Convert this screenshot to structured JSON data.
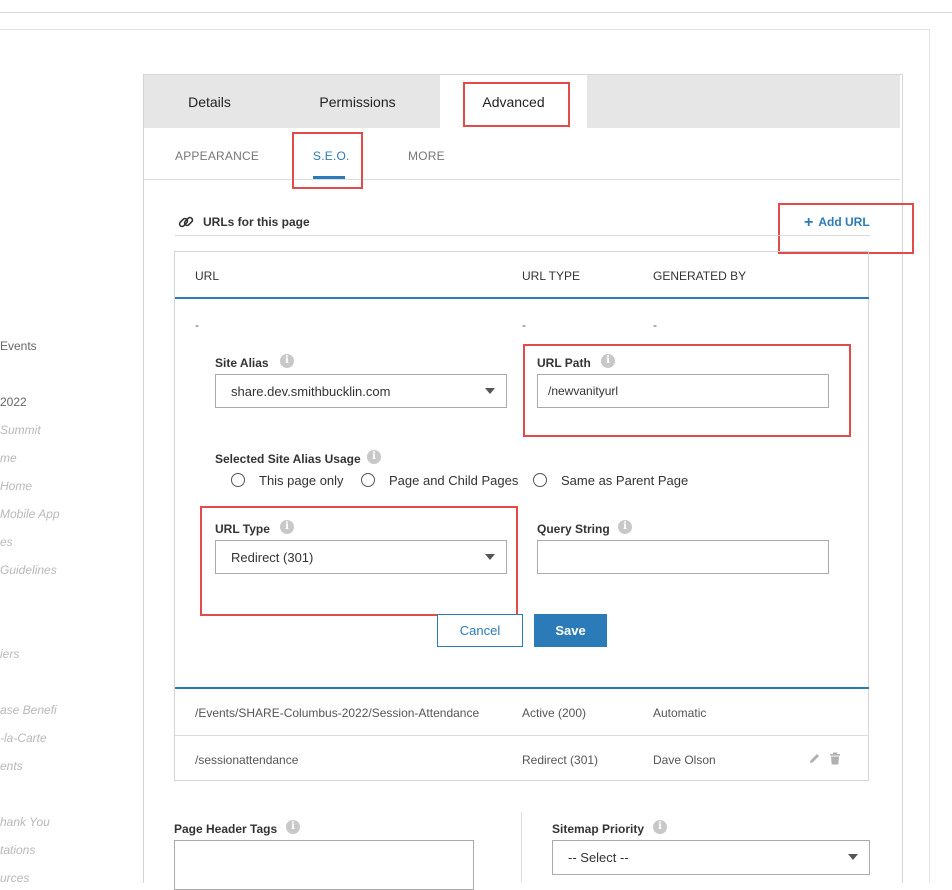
{
  "left_nav": {
    "items": [
      {
        "label": "Events",
        "style": "solid"
      },
      {
        "label": "2022",
        "style": "solid"
      },
      {
        "label": "Summit",
        "style": "faded"
      },
      {
        "label": "me",
        "style": "faded"
      },
      {
        "label": "Home",
        "style": "faded"
      },
      {
        "label": "Mobile App",
        "style": "faded"
      },
      {
        "label": "es",
        "style": "faded"
      },
      {
        "label": "Guidelines",
        "style": "faded"
      },
      {
        "label": "iers",
        "style": "faded"
      },
      {
        "label": "ase Benefi",
        "style": "faded"
      },
      {
        "label": "-la-Carte",
        "style": "faded"
      },
      {
        "label": "ents",
        "style": "faded"
      },
      {
        "label": "hank You",
        "style": "faded"
      },
      {
        "label": "tations",
        "style": "faded"
      },
      {
        "label": "urces",
        "style": "faded"
      }
    ]
  },
  "tabs": [
    {
      "label": "Details",
      "active": false
    },
    {
      "label": "Permissions",
      "active": false
    },
    {
      "label": "Advanced",
      "active": true
    }
  ],
  "subtabs": [
    {
      "label": "APPEARANCE",
      "active": false
    },
    {
      "label": "S.E.O.",
      "active": true
    },
    {
      "label": "MORE",
      "active": false
    }
  ],
  "urls_section": {
    "title": "URLs for this page",
    "add_url_label": "Add URL"
  },
  "url_table": {
    "headers": [
      "URL",
      "URL TYPE",
      "GENERATED BY"
    ],
    "editing_row": [
      "-",
      "-",
      "-"
    ],
    "rows": [
      {
        "url": "/Events/SHARE-Columbus-2022/Session-Attendance",
        "type": "Active (200)",
        "generated_by": "Automatic"
      },
      {
        "url": "/sessionattendance",
        "type": "Redirect (301)",
        "generated_by": "Dave Olson"
      }
    ]
  },
  "form": {
    "site_alias_label": "Site Alias",
    "site_alias_value": "share.dev.smithbucklin.com",
    "url_path_label": "URL Path",
    "url_path_value": "/newvanityurl",
    "usage_label": "Selected Site Alias Usage",
    "usage_options": [
      "This page only",
      "Page and Child Pages",
      "Same as Parent Page"
    ],
    "url_type_label": "URL Type",
    "url_type_value": "Redirect (301)",
    "query_string_label": "Query String",
    "query_string_value": "",
    "cancel_label": "Cancel",
    "save_label": "Save"
  },
  "bottom": {
    "page_header_tags_label": "Page Header Tags",
    "sitemap_priority_label": "Sitemap Priority",
    "sitemap_priority_value": "-- Select --"
  },
  "colors": {
    "accent": "#2b7bb9",
    "highlight": "#e24b4b"
  }
}
